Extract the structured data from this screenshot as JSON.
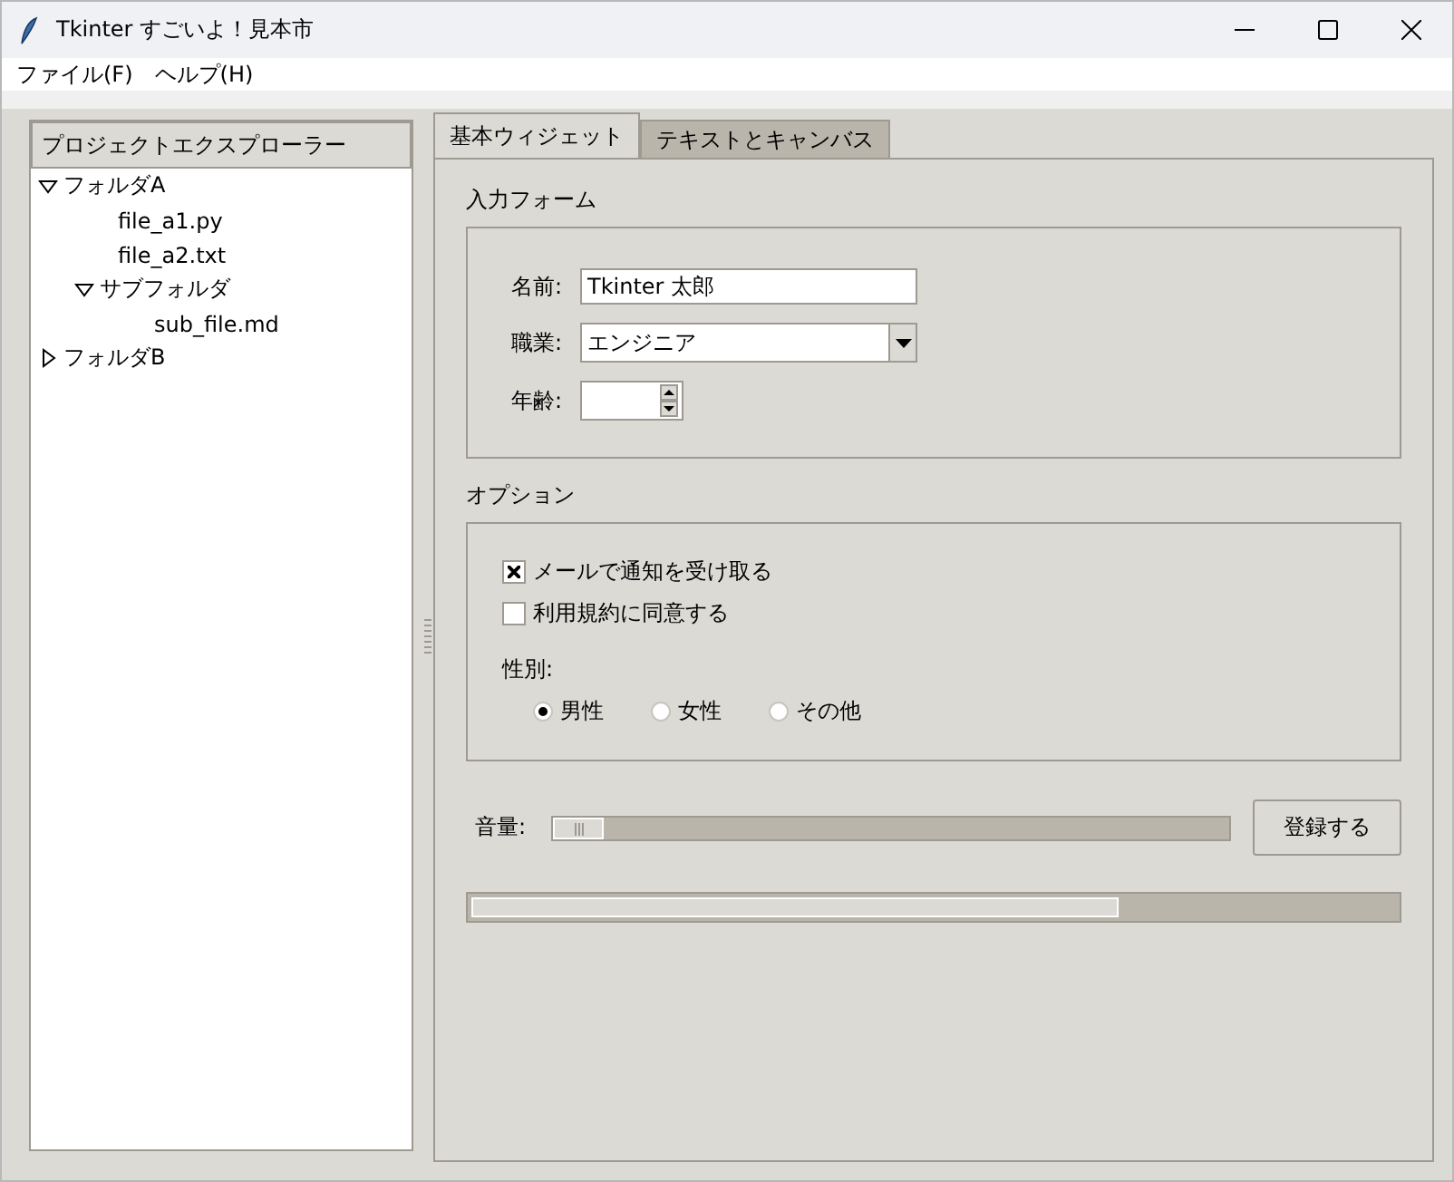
{
  "window": {
    "title": "Tkinter すごいよ！見本市"
  },
  "menu": [
    {
      "label": "ファイル(F)"
    },
    {
      "label": "ヘルプ(H)"
    }
  ],
  "explorer": {
    "heading": "プロジェクトエクスプローラー",
    "items": [
      {
        "label": "フォルダA",
        "expanded": true,
        "children": [
          {
            "label": "file_a1.py"
          },
          {
            "label": "file_a2.txt"
          },
          {
            "label": "サブフォルダ",
            "expanded": true,
            "children": [
              {
                "label": "sub_file.md"
              }
            ]
          }
        ]
      },
      {
        "label": "フォルダB",
        "expanded": false
      }
    ]
  },
  "tabs": [
    {
      "label": "基本ウィジェット",
      "selected": true
    },
    {
      "label": "テキストとキャンバス",
      "selected": false
    }
  ],
  "form": {
    "title": "入力フォーム",
    "name_label": "名前:",
    "name_value": "Tkinter 太郎",
    "job_label": "職業:",
    "job_value": "エンジニア",
    "age_label": "年齢:"
  },
  "options": {
    "title": "オプション",
    "checkboxes": [
      {
        "label": "メールで通知を受け取る",
        "checked": true
      },
      {
        "label": "利用規約に同意する",
        "checked": false
      }
    ],
    "gender_label": "性別:",
    "radios": [
      {
        "label": "男性",
        "selected": true
      },
      {
        "label": "女性",
        "selected": false
      },
      {
        "label": "その他",
        "selected": false
      }
    ]
  },
  "volume": {
    "label": "音量:",
    "level": 0
  },
  "register_button": "登録する",
  "progress": {
    "level": 0.7
  }
}
